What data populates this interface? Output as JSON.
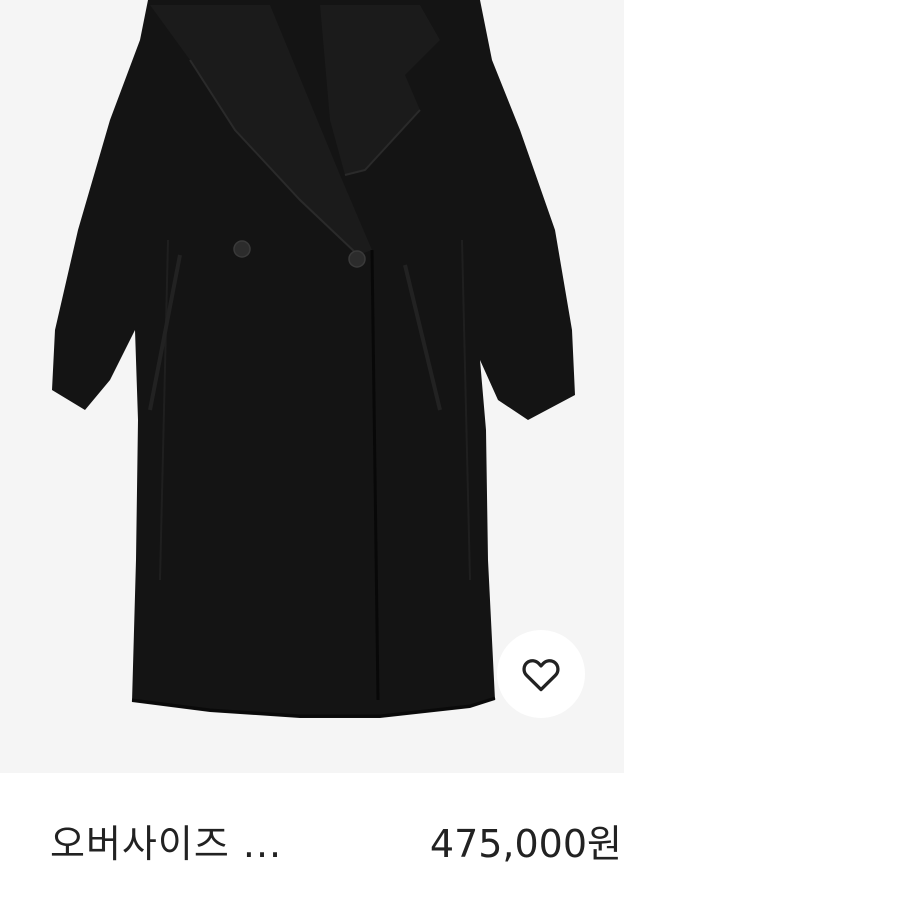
{
  "product": {
    "title": "오버사이즈 ...",
    "price": "475,000원",
    "image_alt": "black oversized double-breasted wool coat",
    "wish_icon": "heart-outline-icon"
  },
  "colors": {
    "image_bg": "#f5f5f5",
    "coat": "#141414",
    "text": "#222222"
  }
}
